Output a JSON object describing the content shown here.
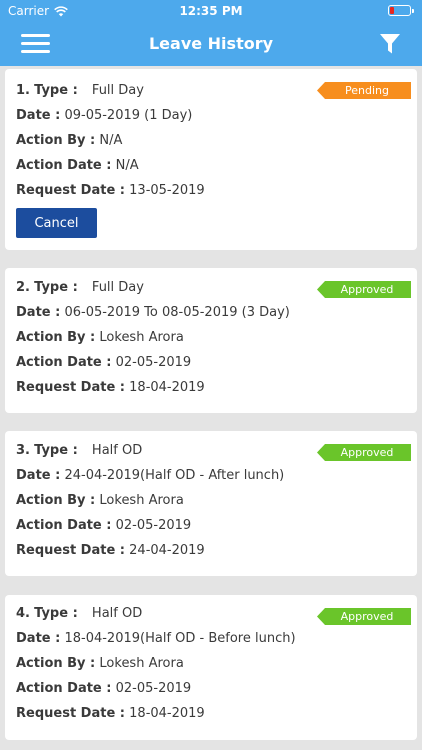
{
  "status_bar": {
    "carrier": "Carrier",
    "time": "12:35 PM"
  },
  "header": {
    "title": "Leave History"
  },
  "labels": {
    "type": "Type :",
    "date": "Date :",
    "action_by": "Action By :",
    "action_date": "Action Date :",
    "request_date": "Request Date :",
    "cancel": "Cancel"
  },
  "colors": {
    "nav": "#4da9ec",
    "pending": "#f78e1e",
    "approved": "#6ac52a",
    "cancel": "#1c4d9e"
  },
  "items": [
    {
      "index": "1.",
      "type": "Full Day",
      "status": "Pending",
      "date": "09-05-2019 (1 Day)",
      "action_by": "N/A",
      "action_date": "N/A",
      "request_date": "13-05-2019"
    },
    {
      "index": "2.",
      "type": "Full Day",
      "status": "Approved",
      "date": "06-05-2019 To 08-05-2019 (3 Day)",
      "action_by": "Lokesh Arora",
      "action_date": "02-05-2019",
      "request_date": "18-04-2019"
    },
    {
      "index": "3.",
      "type": "Half OD",
      "status": "Approved",
      "date": "24-04-2019(Half OD - After lunch)",
      "action_by": "Lokesh Arora",
      "action_date": "02-05-2019",
      "request_date": "24-04-2019"
    },
    {
      "index": "4.",
      "type": "Half OD",
      "status": "Approved",
      "date": "18-04-2019(Half OD - Before lunch)",
      "action_by": "Lokesh Arora",
      "action_date": "02-05-2019",
      "request_date": "18-04-2019"
    }
  ]
}
